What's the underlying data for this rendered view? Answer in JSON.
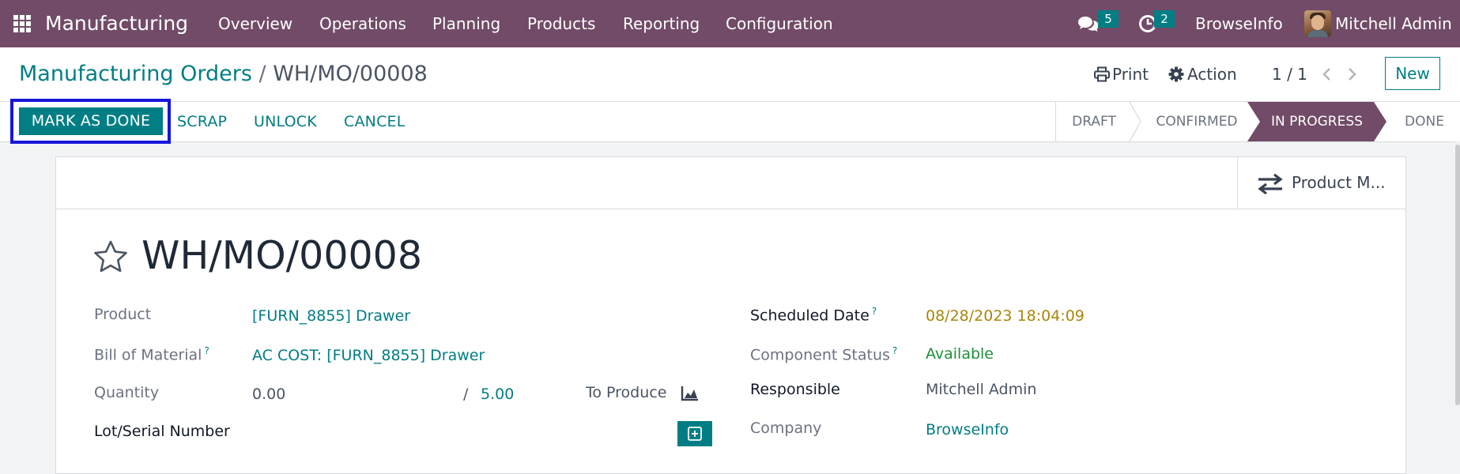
{
  "navbar": {
    "app_name": "Manufacturing",
    "menu": [
      "Overview",
      "Operations",
      "Planning",
      "Products",
      "Reporting",
      "Configuration"
    ],
    "messages_count": "5",
    "activities_count": "2",
    "company": "BrowseInfo",
    "user": "Mitchell Admin",
    "color": "#714b67"
  },
  "breadcrumb": {
    "parent": "Manufacturing Orders",
    "separator": "/",
    "current": "WH/MO/00008"
  },
  "control": {
    "print_label": "Print",
    "action_label": "Action",
    "pager": "1 / 1",
    "new_label": "New"
  },
  "statusbar": {
    "buttons": [
      "MARK AS DONE",
      "SCRAP",
      "UNLOCK",
      "CANCEL"
    ],
    "stages": [
      "DRAFT",
      "CONFIRMED",
      "IN PROGRESS",
      "DONE"
    ],
    "active_stage": "IN PROGRESS",
    "accent": "#017e84"
  },
  "form": {
    "smart_button": "Product M...",
    "title": "WH/MO/00008",
    "help_mark": "?",
    "left": {
      "product_label": "Product",
      "product_value": "[FURN_8855] Drawer",
      "bom_label": "Bill of Material",
      "bom_value": "AC COST: [FURN_8855] Drawer",
      "quantity_label": "Quantity",
      "quantity_value": "0.00",
      "quantity_sep": "/",
      "quantity_target": "5.00",
      "to_produce": "To Produce",
      "lot_label": "Lot/Serial Number"
    },
    "right": {
      "scheduled_label": "Scheduled Date",
      "scheduled_value": "08/28/2023 18:04:09",
      "component_label": "Component Status",
      "component_value": "Available",
      "responsible_label": "Responsible",
      "responsible_value": "Mitchell Admin",
      "company_label": "Company",
      "company_value": "BrowseInfo"
    }
  }
}
